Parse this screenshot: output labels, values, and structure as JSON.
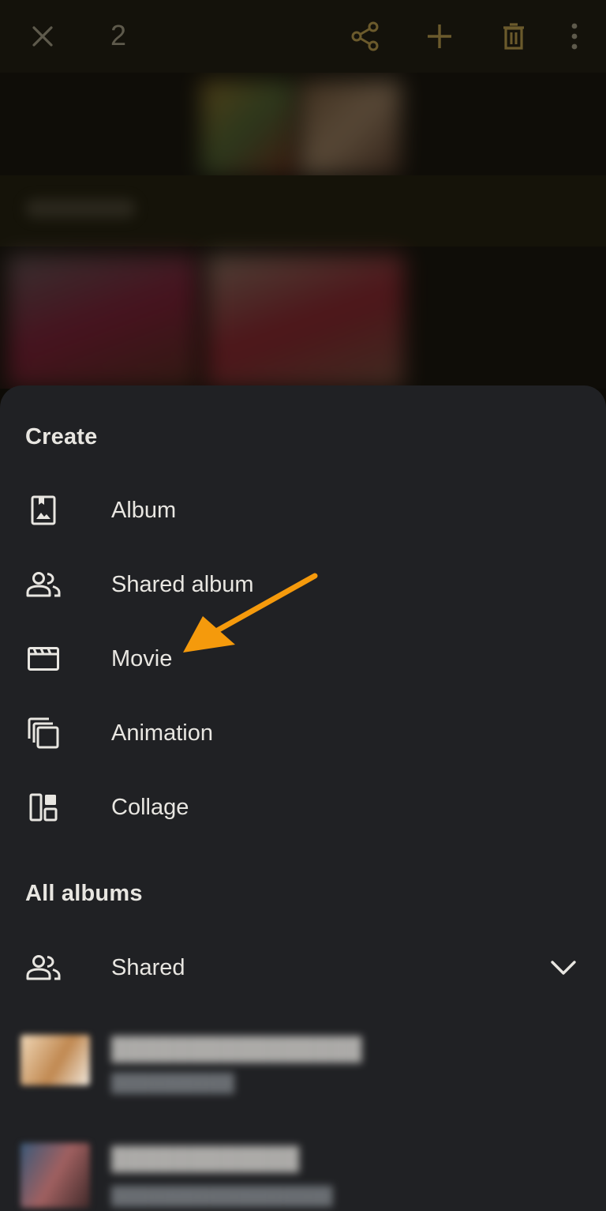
{
  "appbar": {
    "selected_count": "2",
    "icons": [
      "close-icon",
      "share-icon",
      "add-icon",
      "delete-icon",
      "more-vert-icon"
    ]
  },
  "create_section": {
    "title": "Create",
    "items": [
      {
        "label": "Album",
        "icon": "photo-album-icon"
      },
      {
        "label": "Shared album",
        "icon": "people-icon"
      },
      {
        "label": "Movie",
        "icon": "movie-clapper-icon"
      },
      {
        "label": "Animation",
        "icon": "animation-icon"
      },
      {
        "label": "Collage",
        "icon": "collage-icon"
      }
    ]
  },
  "albums_section": {
    "title": "All albums",
    "shared": {
      "label": "Shared",
      "icon": "people-icon",
      "chevron": "chevron-down-icon"
    }
  },
  "colors": {
    "sheet": "#202124",
    "text": "#e8e6e1",
    "annotation_arrow": "#f59a0c"
  }
}
